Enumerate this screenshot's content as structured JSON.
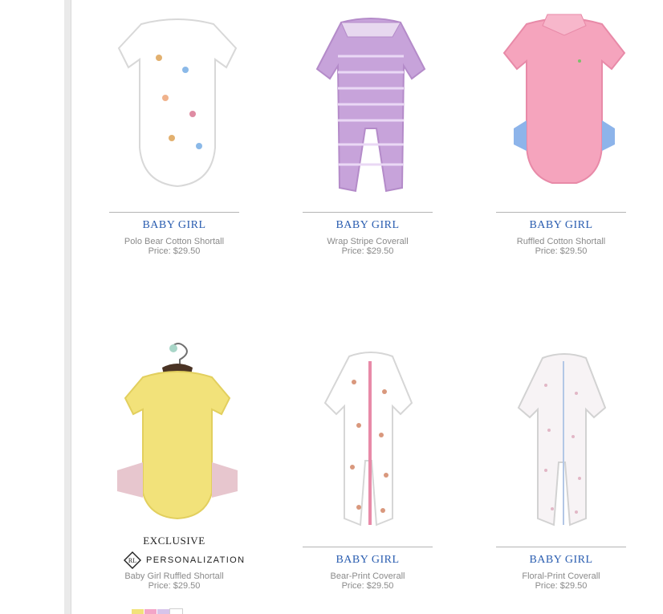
{
  "products": [
    {
      "category": "BABY GIRL",
      "name": "Polo Bear Cotton Shortall",
      "price": "Price: $29.50"
    },
    {
      "category": "BABY GIRL",
      "name": "Wrap Stripe Coverall",
      "price": "Price: $29.50"
    },
    {
      "category": "BABY GIRL",
      "name": "Ruffled Cotton Shortall",
      "price": "Price: $29.50"
    },
    {
      "category": "EXCLUSIVE",
      "personalization": "PERSONALIZATION",
      "logo": "RL",
      "name": "Baby Girl Ruffled Shortall",
      "price": "Price: $29.50",
      "swatch_colors": [
        "#f2e27a",
        "#f3a5c8",
        "#d7c4ea",
        "#ffffff"
      ]
    },
    {
      "category": "BABY GIRL",
      "name": "Bear-Print Coverall",
      "price": "Price: $29.50"
    },
    {
      "category": "BABY GIRL",
      "name": "Floral-Print Coverall",
      "price": "Price: $29.50"
    }
  ],
  "colors": {
    "category_link": "#2a5db0",
    "meta_text": "#8a8a8a",
    "divider": "#eaeaea"
  }
}
